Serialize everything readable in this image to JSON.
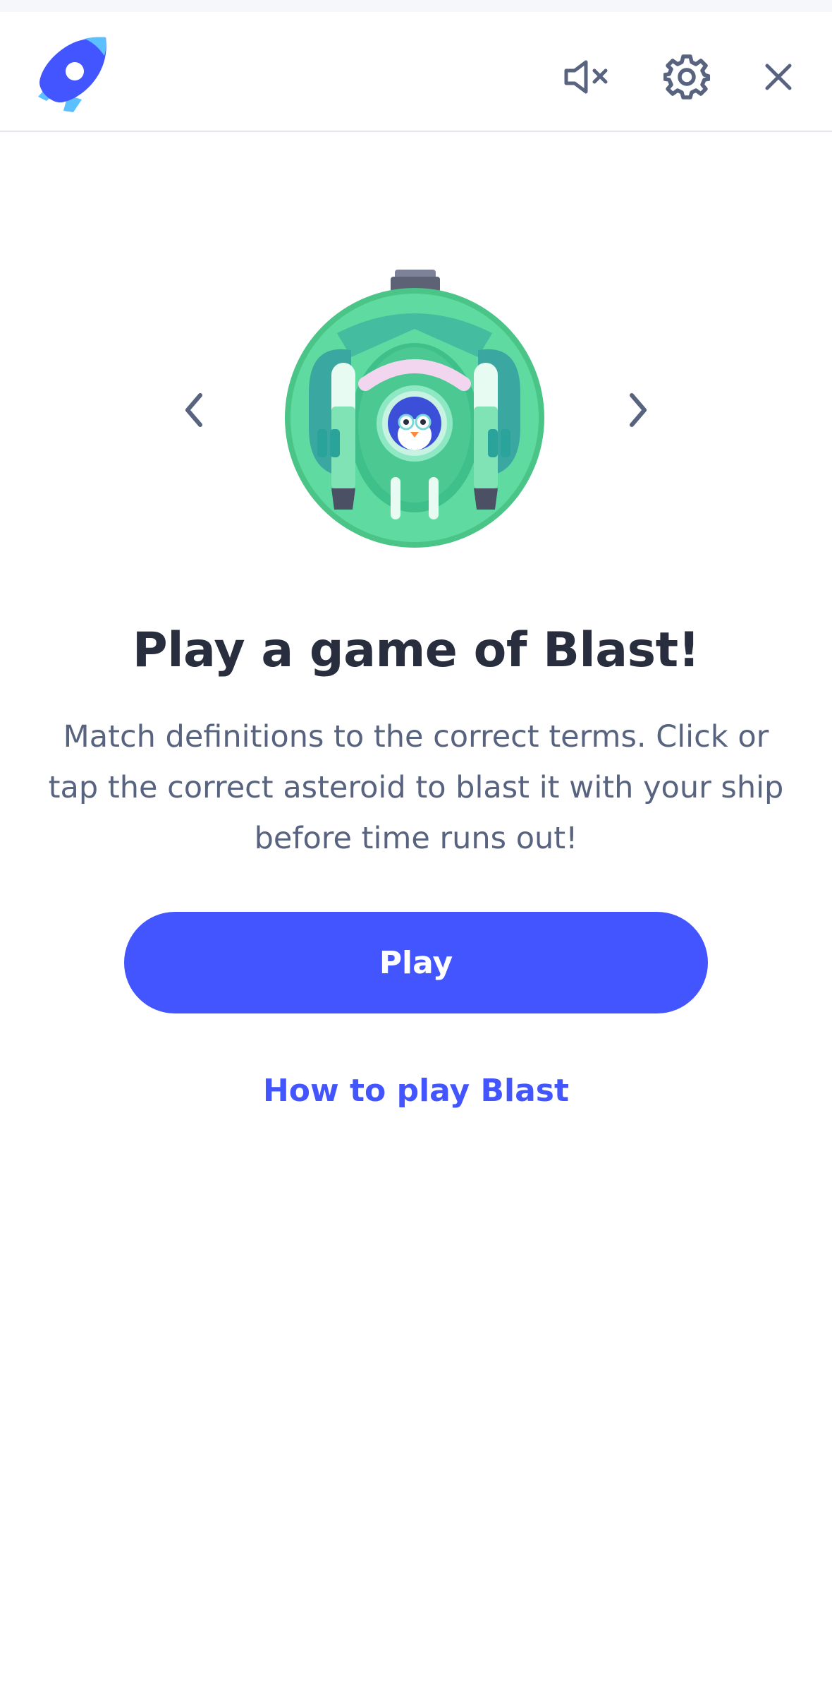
{
  "header": {
    "logo_icon": "rocket-logo-icon",
    "mute_icon": "speaker-muted-icon",
    "settings_icon": "gear-icon",
    "close_icon": "close-icon"
  },
  "carousel": {
    "prev_icon": "chevron-left-icon",
    "next_icon": "chevron-right-icon",
    "illustration": "spaceship-with-penguin-pilot"
  },
  "intro": {
    "title": "Play a game of Blast!",
    "description": "Match definitions to the correct terms. Click or tap the correct asteroid to blast it with your ship before time runs out!"
  },
  "actions": {
    "play_label": "Play",
    "how_to_label": "How to play Blast"
  },
  "colors": {
    "accent": "#4255ff",
    "text_primary": "#282e3e",
    "text_secondary": "#586380",
    "ship_green": "#5fdba1"
  }
}
